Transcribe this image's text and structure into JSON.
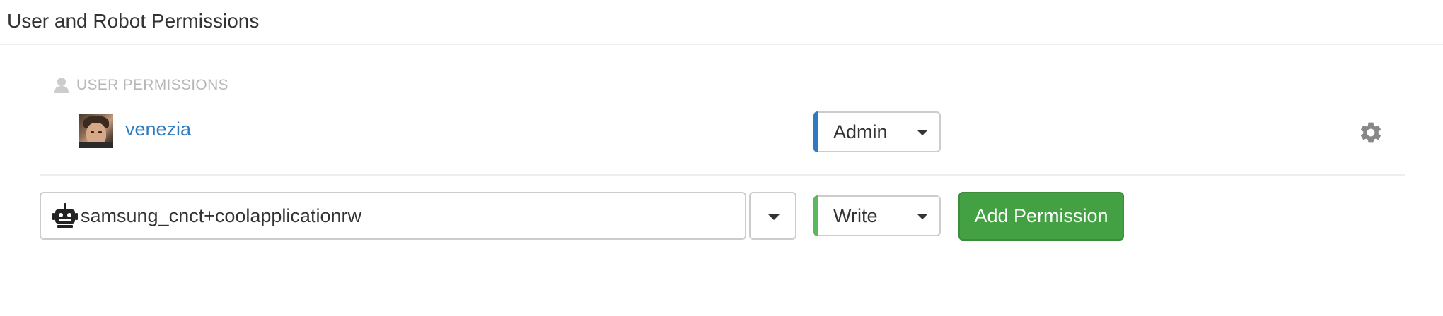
{
  "panel": {
    "title": "User and Robot Permissions"
  },
  "section": {
    "label": "USER PERMISSIONS",
    "icon": "user-icon"
  },
  "users": [
    {
      "name": "venezia",
      "role": "Admin",
      "role_color": "#2f7bbf",
      "settings_icon": "gear-icon"
    }
  ],
  "add_permission": {
    "entity_value": "samsung_cnct+coolapplicationrw",
    "entity_icon": "robot-icon",
    "role": "Write",
    "role_color": "#5cb85c",
    "button_label": "Add Permission",
    "button_color": "#43a043"
  }
}
